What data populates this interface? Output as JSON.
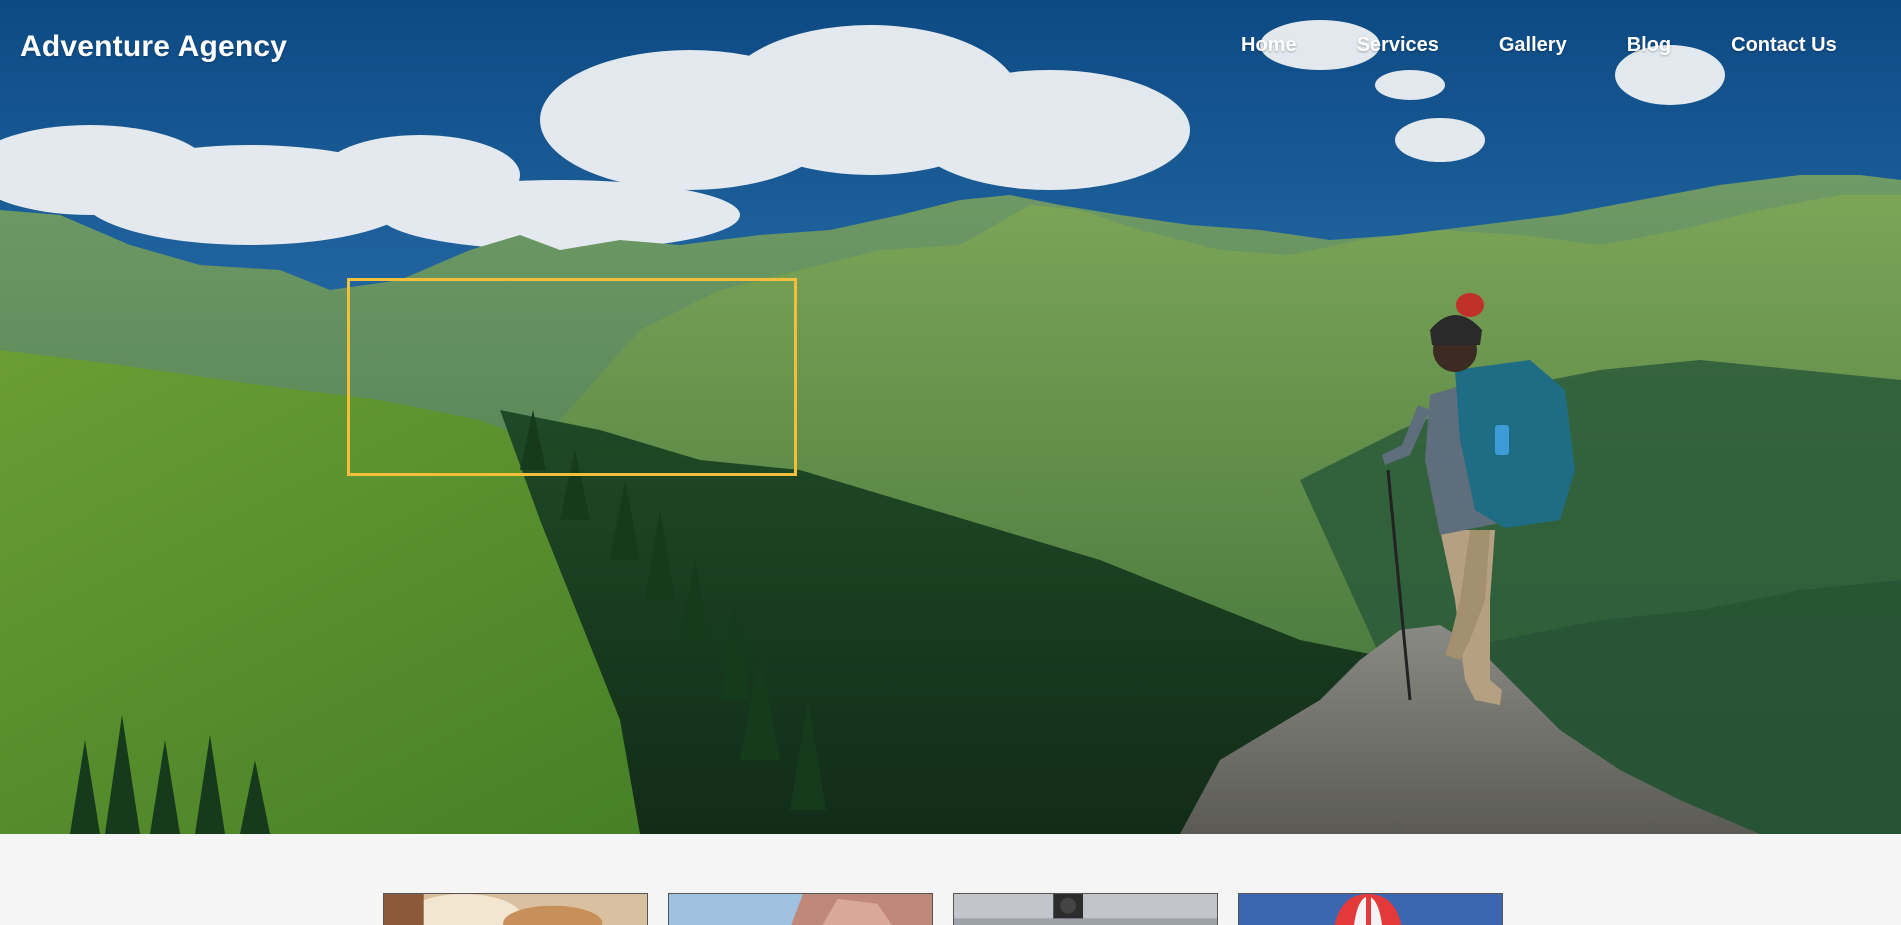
{
  "header": {
    "brand": "Adventure Agency"
  },
  "nav": {
    "items": [
      {
        "label": "Home"
      },
      {
        "label": "Services"
      },
      {
        "label": "Gallery"
      },
      {
        "label": "Blog"
      },
      {
        "label": "Contact Us"
      }
    ]
  },
  "hero": {
    "highlight_color": "#f2bf3a",
    "image": "hiker-on-mountain-ridge"
  },
  "cards": [
    {
      "image": "adventure-thumb-1",
      "tone": "#d9c0a0"
    },
    {
      "image": "adventure-thumb-2",
      "tone": "#c99a8a"
    },
    {
      "image": "adventure-thumb-3",
      "tone": "#b6b8bd"
    },
    {
      "image": "adventure-thumb-4",
      "tone": "#3d66b0"
    }
  ]
}
